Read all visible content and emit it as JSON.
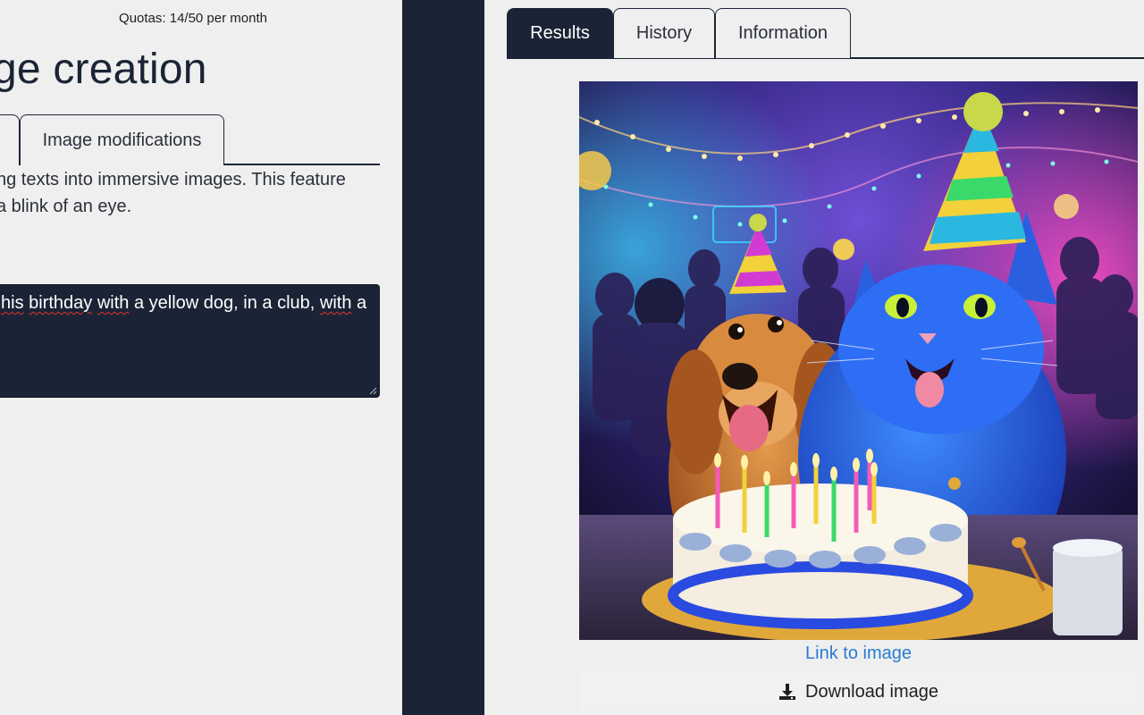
{
  "left": {
    "quota_text": "Quotas: 14/50 per month",
    "page_title": "ge creation",
    "tabs": [
      {
        "label": ""
      },
      {
        "label": "Image modifications"
      }
    ],
    "description_lines": [
      "ng texts into immersive images. This feature",
      "a blink of an eye."
    ],
    "small_label": ".",
    "prompt": {
      "before": " ",
      "word1": "his",
      "space1": " ",
      "word2": "birthday",
      "mid": " ",
      "word3": "with",
      "rest": " a yellow dog, in a club, ",
      "word4": "with",
      "tail": " a"
    }
  },
  "right": {
    "tabs": [
      {
        "label": "Results",
        "active": true
      },
      {
        "label": "History",
        "active": false
      },
      {
        "label": "Information",
        "active": false
      }
    ],
    "image_alt": "dog and cat birthday party",
    "link_label": "Link to image",
    "download_label": "Download image"
  },
  "colors": {
    "navy": "#1b2436",
    "panel_bg": "#efefef",
    "link": "#2a7bd1",
    "spell_error": "#e2322b"
  }
}
